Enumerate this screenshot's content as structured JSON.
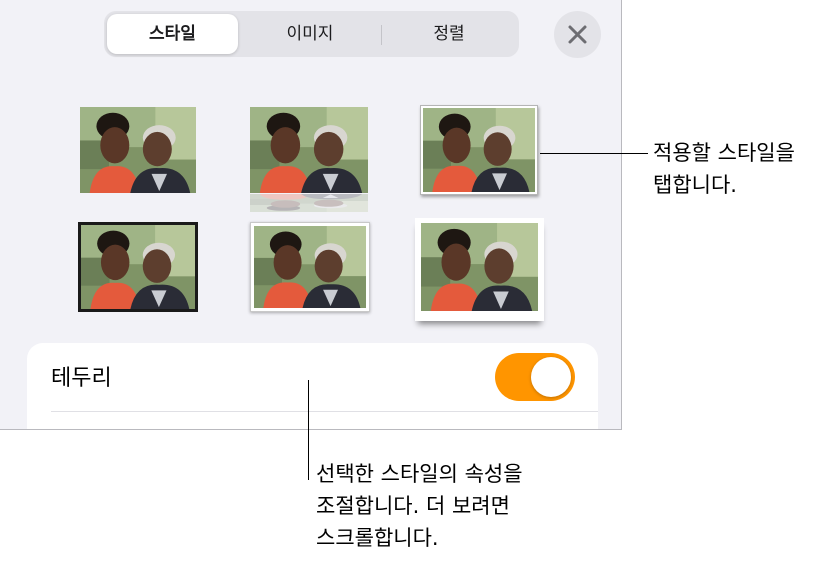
{
  "tabs": [
    {
      "label": "스타일",
      "selected": true
    },
    {
      "label": "이미지",
      "selected": false
    },
    {
      "label": "정렬",
      "selected": false
    }
  ],
  "close_icon": "close-icon",
  "style_thumbnails": [
    "photo-style-plain",
    "photo-style-reflection",
    "photo-style-shadow-border",
    "photo-style-thick-frame",
    "photo-style-white-border",
    "photo-style-curled-shadow"
  ],
  "settings": {
    "border_label": "테두리",
    "border_toggle_on": true
  },
  "colors": {
    "accent": "#ff9500",
    "panel_bg": "#f2f2f7"
  },
  "callouts": {
    "tap_style": [
      "적용할 스타일을",
      "탭합니다."
    ],
    "adjust": [
      "선택한 스타일의 속성을",
      "조절합니다. 더 보려면",
      "스크롤합니다."
    ]
  }
}
